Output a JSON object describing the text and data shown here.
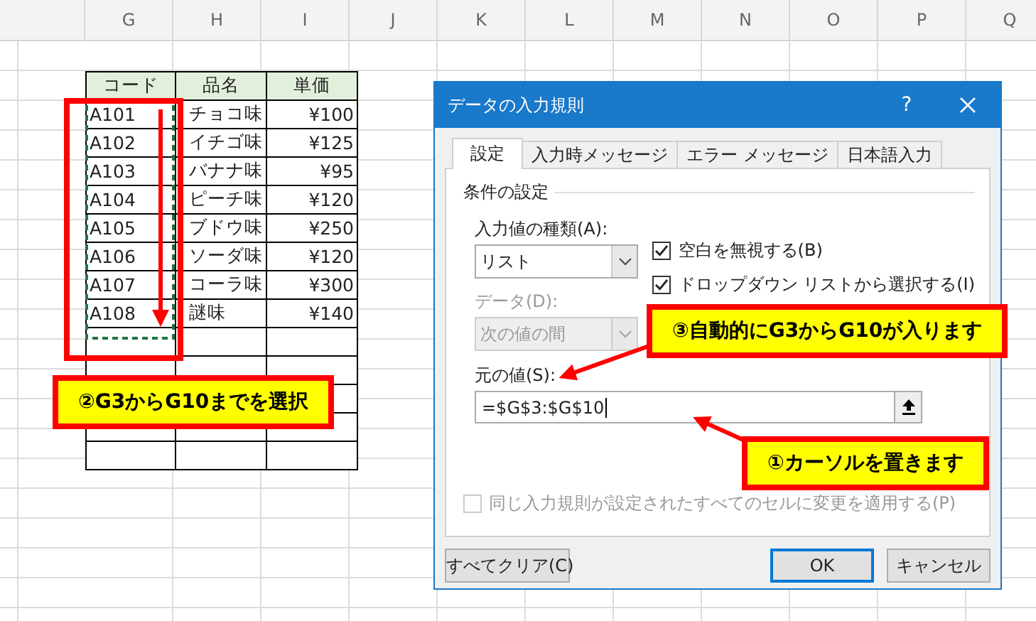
{
  "sheet": {
    "columns": [
      "G",
      "H",
      "I",
      "J",
      "K",
      "L",
      "M",
      "N",
      "O",
      "P",
      "Q"
    ],
    "table": {
      "headers": [
        "コード",
        "品名",
        "単価"
      ],
      "rows": [
        {
          "code": "A101",
          "name": "チョコ味",
          "price": "¥100"
        },
        {
          "code": "A102",
          "name": "イチゴ味",
          "price": "¥125"
        },
        {
          "code": "A103",
          "name": "バナナ味",
          "price": "¥95"
        },
        {
          "code": "A104",
          "name": "ピーチ味",
          "price": "¥120"
        },
        {
          "code": "A105",
          "name": "ブドウ味",
          "price": "¥250"
        },
        {
          "code": "A106",
          "name": "ソーダ味",
          "price": "¥120"
        },
        {
          "code": "A107",
          "name": "コーラ味",
          "price": "¥300"
        },
        {
          "code": "A108",
          "name": "謎味",
          "price": "¥140"
        }
      ]
    }
  },
  "dialog": {
    "title": "データの入力規則",
    "help_button": "?",
    "tabs": [
      {
        "label": "設定",
        "selected": true
      },
      {
        "label": "入力時メッセージ",
        "selected": false
      },
      {
        "label": "エラー メッセージ",
        "selected": false
      },
      {
        "label": "日本語入力",
        "selected": false
      }
    ],
    "group_label": "条件の設定",
    "allow": {
      "label": "入力値の種類(A):",
      "value": "リスト",
      "disabled": false
    },
    "checkboxes": [
      {
        "label": "空白を無視する(B)",
        "checked": true,
        "disabled": false
      },
      {
        "label": "ドロップダウン リストから選択する(I)",
        "checked": true,
        "disabled": false
      }
    ],
    "data": {
      "label": "データ(D):",
      "value": "次の値の間",
      "disabled": true
    },
    "source": {
      "label": "元の値(S):",
      "value": "=$G$3:$G$10"
    },
    "apply_all": {
      "label": "同じ入力規則が設定されたすべてのセルに変更を適用する(P)",
      "checked": false,
      "disabled": true
    },
    "buttons": [
      {
        "label": "すべてクリア(C)",
        "default": false
      },
      {
        "label": "OK",
        "default": true
      },
      {
        "label": "キャンセル",
        "default": false
      }
    ]
  },
  "callouts": [
    {
      "text": "②G3からG10までを選択"
    },
    {
      "text": "③自動的にG3からG10が入ります"
    },
    {
      "text": "①カーソルを置きます"
    }
  ]
}
